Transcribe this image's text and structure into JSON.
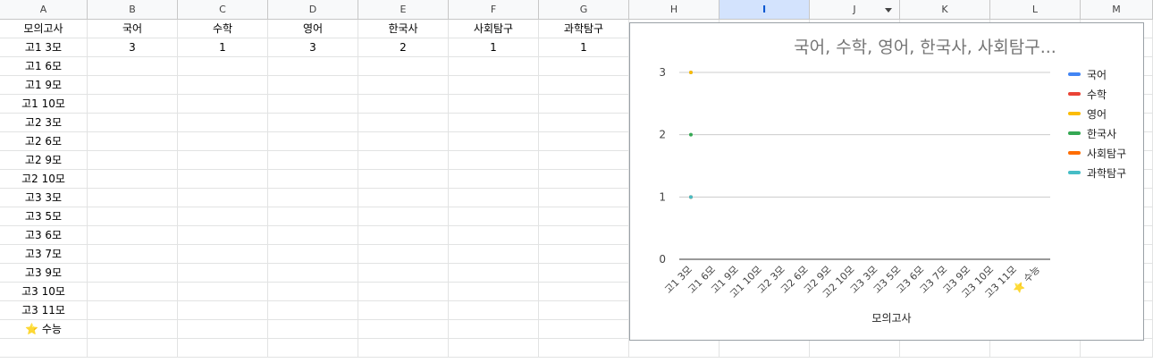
{
  "columns": [
    "A",
    "B",
    "C",
    "D",
    "E",
    "F",
    "G",
    "H",
    "I",
    "J",
    "K",
    "L",
    "M"
  ],
  "selected_column": "I",
  "headers": [
    "모의고사",
    "국어",
    "수학",
    "영어",
    "한국사",
    "사회탐구",
    "과학탐구"
  ],
  "rows": [
    {
      "label": "고1 3모",
      "values": [
        "3",
        "1",
        "3",
        "2",
        "1",
        "1"
      ]
    },
    {
      "label": "고1 6모",
      "values": [
        "",
        "",
        "",
        "",
        "",
        ""
      ]
    },
    {
      "label": "고1 9모",
      "values": [
        "",
        "",
        "",
        "",
        "",
        ""
      ]
    },
    {
      "label": "고1 10모",
      "values": [
        "",
        "",
        "",
        "",
        "",
        ""
      ]
    },
    {
      "label": "고2 3모",
      "values": [
        "",
        "",
        "",
        "",
        "",
        ""
      ]
    },
    {
      "label": "고2 6모",
      "values": [
        "",
        "",
        "",
        "",
        "",
        ""
      ]
    },
    {
      "label": "고2 9모",
      "values": [
        "",
        "",
        "",
        "",
        "",
        ""
      ]
    },
    {
      "label": "고2 10모",
      "values": [
        "",
        "",
        "",
        "",
        "",
        ""
      ]
    },
    {
      "label": "고3 3모",
      "values": [
        "",
        "",
        "",
        "",
        "",
        ""
      ]
    },
    {
      "label": "고3 5모",
      "values": [
        "",
        "",
        "",
        "",
        "",
        ""
      ]
    },
    {
      "label": "고3 6모",
      "values": [
        "",
        "",
        "",
        "",
        "",
        ""
      ]
    },
    {
      "label": "고3 7모",
      "values": [
        "",
        "",
        "",
        "",
        "",
        ""
      ]
    },
    {
      "label": "고3 9모",
      "values": [
        "",
        "",
        "",
        "",
        "",
        ""
      ]
    },
    {
      "label": "고3 10모",
      "values": [
        "",
        "",
        "",
        "",
        "",
        ""
      ]
    },
    {
      "label": "고3 11모",
      "values": [
        "",
        "",
        "",
        "",
        "",
        ""
      ]
    },
    {
      "label": "⭐ 수능",
      "values": [
        "",
        "",
        "",
        "",
        "",
        ""
      ]
    }
  ],
  "chart_data": {
    "type": "line",
    "title": "국어, 수학, 영어, 한국사, 사회탐구...",
    "xlabel": "모의고사",
    "ylabel": "",
    "ylim": [
      0,
      3
    ],
    "yticks": [
      "0",
      "1",
      "2",
      "3"
    ],
    "categories": [
      "고1 3모",
      "고1 6모",
      "고1 9모",
      "고1 10모",
      "고2 3모",
      "고2 6모",
      "고2 9모",
      "고2 10모",
      "고3 3모",
      "고3 5모",
      "고3 6모",
      "고3 7모",
      "고3 9모",
      "고3 10모",
      "고3 11모",
      "⭐ 수능"
    ],
    "series": [
      {
        "name": "국어",
        "color": "#4285f4",
        "values": [
          3
        ]
      },
      {
        "name": "수학",
        "color": "#ea4335",
        "values": [
          1
        ]
      },
      {
        "name": "영어",
        "color": "#fbbc04",
        "values": [
          3
        ]
      },
      {
        "name": "한국사",
        "color": "#34a853",
        "values": [
          2
        ]
      },
      {
        "name": "사회탐구",
        "color": "#ff6d01",
        "values": [
          1
        ]
      },
      {
        "name": "과학탐구",
        "color": "#46bdc6",
        "values": [
          1
        ]
      }
    ],
    "legend": "right",
    "grid": true
  }
}
